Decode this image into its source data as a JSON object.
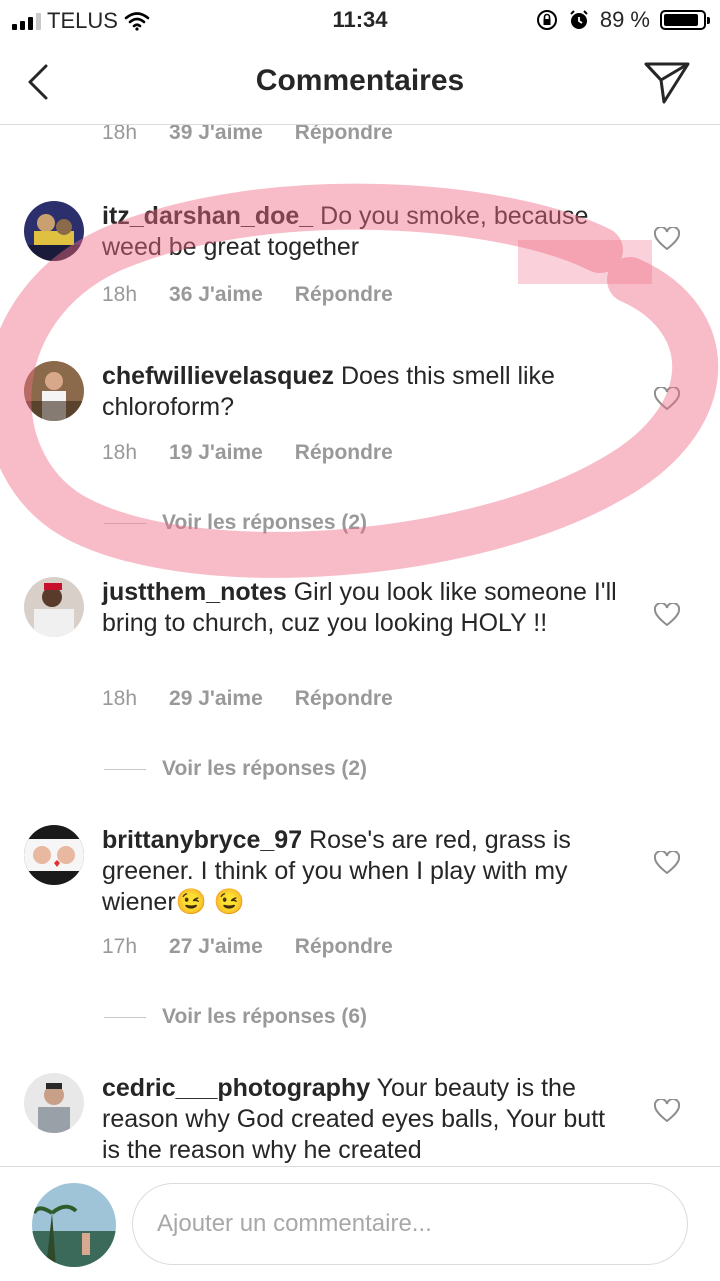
{
  "status_bar": {
    "carrier": "TELUS",
    "time": "11:34",
    "battery": "89 %",
    "battery_level": 0.89
  },
  "header": {
    "title": "Commentaires"
  },
  "top_meta": {
    "time": "18h",
    "likes": "39 J'aime",
    "reply": "Répondre"
  },
  "comments": [
    {
      "username": "itz_darshan_doe_",
      "text": "Do you smoke, because weed be great together",
      "time": "18h",
      "likes": "36 J'aime",
      "reply": "Répondre"
    },
    {
      "username": "chefwillievelasquez",
      "text": "Does this smell like chloroform?",
      "time": "18h",
      "likes": "19 J'aime",
      "reply": "Répondre",
      "view_replies": "Voir les réponses (2)"
    },
    {
      "username": "justthem_notes",
      "text": "Girl you look like someone I'll bring to church, cuz you looking HOLY !!",
      "time": "18h",
      "likes": "29 J'aime",
      "reply": "Répondre",
      "view_replies": "Voir les réponses (2)"
    },
    {
      "username": "brittanybryce_97",
      "text": "Rose's are red, grass is greener. I think of you when I play with my wiener😉 😉",
      "time": "17h",
      "likes": "27 J'aime",
      "reply": "Répondre",
      "view_replies": "Voir les réponses (6)"
    },
    {
      "username": "cedric___photography",
      "text": "Your beauty is the reason why God created eyes balls, Your butt is the reason why he created"
    }
  ],
  "compose": {
    "placeholder": "Ajouter un commentaire..."
  },
  "colors": {
    "meta_gray": "#999999",
    "text": "#262626",
    "divider": "#dbdbdb",
    "highlight_pink": "#f06b86"
  },
  "icons": [
    "back-chevron-icon",
    "send-direct-icon",
    "heart-outline-icon",
    "signal-icon",
    "wifi-icon",
    "rotation-lock-icon",
    "alarm-icon",
    "battery-icon"
  ]
}
